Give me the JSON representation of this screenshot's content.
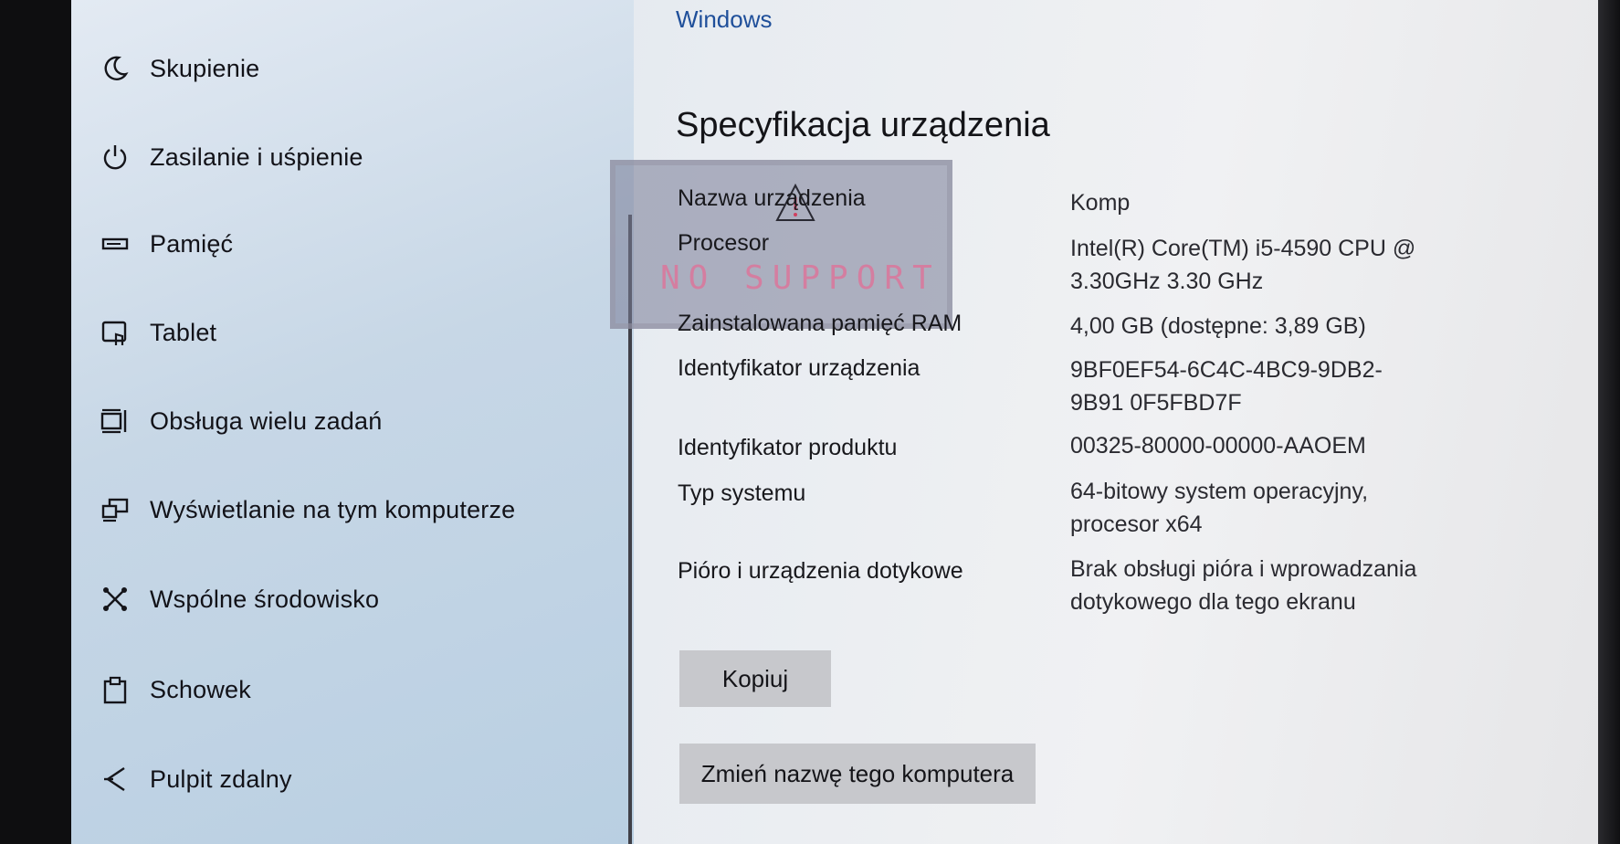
{
  "top_link": "Windows",
  "sidebar": {
    "items": [
      {
        "label": "Skupienie",
        "icon": "moon-icon"
      },
      {
        "label": "Zasilanie i uśpienie",
        "icon": "power-icon"
      },
      {
        "label": "Pamięć",
        "icon": "storage-icon"
      },
      {
        "label": "Tablet",
        "icon": "tablet-icon"
      },
      {
        "label": "Obsługa wielu zadań",
        "icon": "multitasking-icon"
      },
      {
        "label": "Wyświetlanie na tym komputerze",
        "icon": "projecting-icon"
      },
      {
        "label": "Wspólne środowisko",
        "icon": "shared-experiences-icon"
      },
      {
        "label": "Schowek",
        "icon": "clipboard-icon"
      },
      {
        "label": "Pulpit zdalny",
        "icon": "remote-desktop-icon"
      }
    ]
  },
  "device_specs": {
    "title": "Specyfikacja urządzenia",
    "rows": [
      {
        "label": "Nazwa urządzenia",
        "value": "Komp"
      },
      {
        "label": "Procesor",
        "value": "Intel(R) Core(TM) i5-4590 CPU @ 3.30GHz   3.30 GHz"
      },
      {
        "label": "Zainstalowana pamięć RAM",
        "value": "4,00 GB (dostępne: 3,89 GB)"
      },
      {
        "label": "Identyfikator urządzenia",
        "value": "9BF0EF54-6C4C-4BC9-9DB2-9B91 0F5FBD7F"
      },
      {
        "label": "Identyfikator produktu",
        "value": "00325-80000-00000-AAOEM"
      },
      {
        "label": "Typ systemu",
        "value": "64-bitowy system operacyjny, procesor x64"
      },
      {
        "label": "Pióro i urządzenia dotykowe",
        "value": "Brak obsługi pióra i wprowadzania dotykowego dla tego ekranu"
      }
    ],
    "copy_button": "Kopiuj",
    "rename_button": "Zmień nazwę tego komputera"
  },
  "overlay": {
    "text": "NO SUPPORT",
    "icon": "warning-triangle-icon"
  }
}
